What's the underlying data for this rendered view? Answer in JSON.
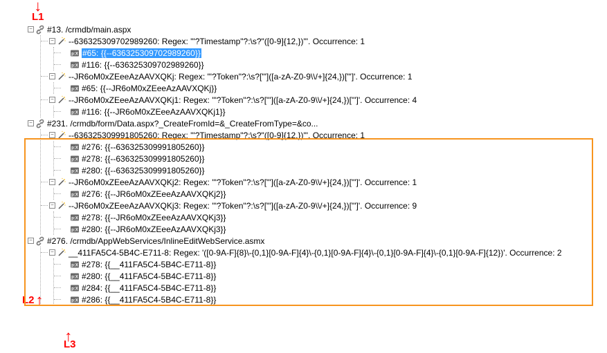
{
  "annotations": {
    "L1": "L1",
    "L2": "L2",
    "L3": "L3"
  },
  "tree": [
    {
      "icon": "link",
      "exp": true,
      "label": "#13. /crmdb/main.aspx",
      "children": [
        {
          "icon": "wand",
          "exp": true,
          "label": "--636325309702989260: Regex: '\"?Timestamp\"?:\\s?\"([0-9]{12,})\"'. Occurrence: 1",
          "children": [
            {
              "icon": "pxbox",
              "label": "#65: {{--636325309702989260}}",
              "selected": true
            },
            {
              "icon": "pxbox",
              "label": "#116: {{--636325309702989260}}"
            }
          ]
        },
        {
          "icon": "wand",
          "exp": true,
          "label": "--JR6oM0xZEeeAzAAVXQKj: Regex: '\"?Token\"?:\\s?[\"']([a-zA-Z0-9\\\\/+]{24,})[\"']'. Occurrence: 1",
          "children": [
            {
              "icon": "pxbox",
              "label": "#65: {{--JR6oM0xZEeeAzAAVXQKj}}"
            }
          ]
        },
        {
          "icon": "wand",
          "exp": true,
          "label": "--JR6oM0xZEeeAzAAVXQKj1: Regex: '\"?Token\"?:\\s?[\"']([a-zA-Z0-9\\\\/+]{24,})[\"']'. Occurrence: 4",
          "children": [
            {
              "icon": "pxbox",
              "label": "#116: {{--JR6oM0xZEeeAzAAVXQKj1}}"
            }
          ]
        }
      ]
    },
    {
      "icon": "link",
      "exp": true,
      "label": "#231. /crmdb/form/Data.aspx?_CreateFromId=&_CreateFromType=&co...",
      "children": [
        {
          "icon": "wand",
          "exp": true,
          "label": "--636325309991805260: Regex: '\"?Timestamp\"?:\\s?\"([0-9]{12,})\"'. Occurrence: 1",
          "children": [
            {
              "icon": "pxbox",
              "label": "#276: {{--636325309991805260}}"
            },
            {
              "icon": "pxbox",
              "label": "#278: {{--636325309991805260}}"
            },
            {
              "icon": "pxbox",
              "label": "#280: {{--636325309991805260}}"
            }
          ]
        },
        {
          "icon": "wand",
          "exp": true,
          "label": "--JR6oM0xZEeeAzAAVXQKj2: Regex: '\"?Token\"?:\\s?[\"']([a-zA-Z0-9\\\\/+]{24,})[\"']'. Occurrence: 1",
          "children": [
            {
              "icon": "pxbox",
              "label": "#276: {{--JR6oM0xZEeeAzAAVXQKj2}}"
            }
          ]
        },
        {
          "icon": "wand",
          "exp": true,
          "label": "--JR6oM0xZEeeAzAAVXQKj3: Regex: '\"?Token\"?:\\s?[\"']([a-zA-Z0-9\\\\/+]{24,})[\"']'. Occurrence: 9",
          "children": [
            {
              "icon": "pxbox",
              "label": "#278: {{--JR6oM0xZEeeAzAAVXQKj3}}"
            },
            {
              "icon": "pxbox",
              "label": "#280: {{--JR6oM0xZEeeAzAAVXQKj3}}"
            }
          ]
        }
      ]
    },
    {
      "icon": "link",
      "exp": true,
      "label": "#276. /crmdb/AppWebServices/InlineEditWebService.asmx",
      "children": [
        {
          "icon": "wand",
          "exp": true,
          "label": "__411FA5C4-5B4C-E711-8: Regex: '([0-9A-F]{8}\\-{0,1}[0-9A-F]{4}\\-{0,1}[0-9A-F]{4}\\-{0,1}[0-9A-F]{4}\\-{0,1}[0-9A-F]{12})'. Occurrence: 2",
          "children": [
            {
              "icon": "pxbox",
              "label": "#278: {{__411FA5C4-5B4C-E711-8}}"
            },
            {
              "icon": "pxbox",
              "label": "#280: {{__411FA5C4-5B4C-E711-8}}"
            },
            {
              "icon": "pxbox",
              "label": "#284: {{__411FA5C4-5B4C-E711-8}}"
            },
            {
              "icon": "pxbox",
              "label": "#286: {{__411FA5C4-5B4C-E711-8}}"
            }
          ]
        }
      ]
    }
  ]
}
